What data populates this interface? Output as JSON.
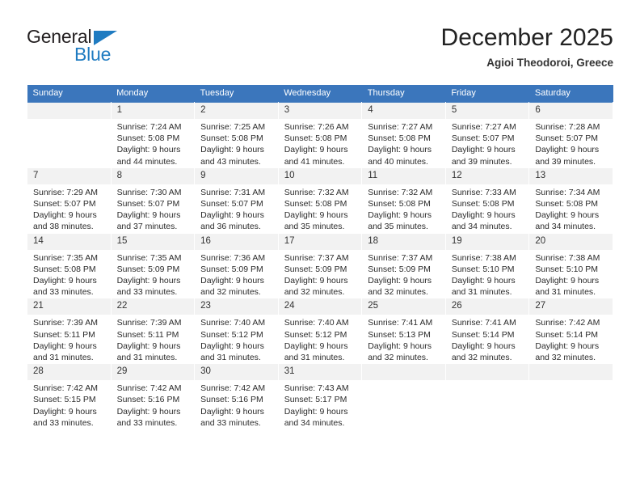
{
  "brand": {
    "name_top": "General",
    "name_bottom": "Blue",
    "triangle_icon": "triangle-icon",
    "color_blue": "#1f7bc1",
    "color_dark": "#231f20"
  },
  "header": {
    "title": "December 2025",
    "subtitle": "Agioi Theodoroi, Greece",
    "accent_color": "#3b76bc"
  },
  "calendar": {
    "weekday_headers": [
      "Sunday",
      "Monday",
      "Tuesday",
      "Wednesday",
      "Thursday",
      "Friday",
      "Saturday"
    ],
    "weeks": [
      [
        {
          "day": "",
          "sunrise": "",
          "sunset": "",
          "daylight_1": "",
          "daylight_2": "",
          "empty": true
        },
        {
          "day": "1",
          "sunrise": "Sunrise: 7:24 AM",
          "sunset": "Sunset: 5:08 PM",
          "daylight_1": "Daylight: 9 hours",
          "daylight_2": "and 44 minutes."
        },
        {
          "day": "2",
          "sunrise": "Sunrise: 7:25 AM",
          "sunset": "Sunset: 5:08 PM",
          "daylight_1": "Daylight: 9 hours",
          "daylight_2": "and 43 minutes."
        },
        {
          "day": "3",
          "sunrise": "Sunrise: 7:26 AM",
          "sunset": "Sunset: 5:08 PM",
          "daylight_1": "Daylight: 9 hours",
          "daylight_2": "and 41 minutes."
        },
        {
          "day": "4",
          "sunrise": "Sunrise: 7:27 AM",
          "sunset": "Sunset: 5:08 PM",
          "daylight_1": "Daylight: 9 hours",
          "daylight_2": "and 40 minutes."
        },
        {
          "day": "5",
          "sunrise": "Sunrise: 7:27 AM",
          "sunset": "Sunset: 5:07 PM",
          "daylight_1": "Daylight: 9 hours",
          "daylight_2": "and 39 minutes."
        },
        {
          "day": "6",
          "sunrise": "Sunrise: 7:28 AM",
          "sunset": "Sunset: 5:07 PM",
          "daylight_1": "Daylight: 9 hours",
          "daylight_2": "and 39 minutes."
        }
      ],
      [
        {
          "day": "7",
          "sunrise": "Sunrise: 7:29 AM",
          "sunset": "Sunset: 5:07 PM",
          "daylight_1": "Daylight: 9 hours",
          "daylight_2": "and 38 minutes."
        },
        {
          "day": "8",
          "sunrise": "Sunrise: 7:30 AM",
          "sunset": "Sunset: 5:07 PM",
          "daylight_1": "Daylight: 9 hours",
          "daylight_2": "and 37 minutes."
        },
        {
          "day": "9",
          "sunrise": "Sunrise: 7:31 AM",
          "sunset": "Sunset: 5:07 PM",
          "daylight_1": "Daylight: 9 hours",
          "daylight_2": "and 36 minutes."
        },
        {
          "day": "10",
          "sunrise": "Sunrise: 7:32 AM",
          "sunset": "Sunset: 5:08 PM",
          "daylight_1": "Daylight: 9 hours",
          "daylight_2": "and 35 minutes."
        },
        {
          "day": "11",
          "sunrise": "Sunrise: 7:32 AM",
          "sunset": "Sunset: 5:08 PM",
          "daylight_1": "Daylight: 9 hours",
          "daylight_2": "and 35 minutes."
        },
        {
          "day": "12",
          "sunrise": "Sunrise: 7:33 AM",
          "sunset": "Sunset: 5:08 PM",
          "daylight_1": "Daylight: 9 hours",
          "daylight_2": "and 34 minutes."
        },
        {
          "day": "13",
          "sunrise": "Sunrise: 7:34 AM",
          "sunset": "Sunset: 5:08 PM",
          "daylight_1": "Daylight: 9 hours",
          "daylight_2": "and 34 minutes."
        }
      ],
      [
        {
          "day": "14",
          "sunrise": "Sunrise: 7:35 AM",
          "sunset": "Sunset: 5:08 PM",
          "daylight_1": "Daylight: 9 hours",
          "daylight_2": "and 33 minutes."
        },
        {
          "day": "15",
          "sunrise": "Sunrise: 7:35 AM",
          "sunset": "Sunset: 5:09 PM",
          "daylight_1": "Daylight: 9 hours",
          "daylight_2": "and 33 minutes."
        },
        {
          "day": "16",
          "sunrise": "Sunrise: 7:36 AM",
          "sunset": "Sunset: 5:09 PM",
          "daylight_1": "Daylight: 9 hours",
          "daylight_2": "and 32 minutes."
        },
        {
          "day": "17",
          "sunrise": "Sunrise: 7:37 AM",
          "sunset": "Sunset: 5:09 PM",
          "daylight_1": "Daylight: 9 hours",
          "daylight_2": "and 32 minutes."
        },
        {
          "day": "18",
          "sunrise": "Sunrise: 7:37 AM",
          "sunset": "Sunset: 5:09 PM",
          "daylight_1": "Daylight: 9 hours",
          "daylight_2": "and 32 minutes."
        },
        {
          "day": "19",
          "sunrise": "Sunrise: 7:38 AM",
          "sunset": "Sunset: 5:10 PM",
          "daylight_1": "Daylight: 9 hours",
          "daylight_2": "and 31 minutes."
        },
        {
          "day": "20",
          "sunrise": "Sunrise: 7:38 AM",
          "sunset": "Sunset: 5:10 PM",
          "daylight_1": "Daylight: 9 hours",
          "daylight_2": "and 31 minutes."
        }
      ],
      [
        {
          "day": "21",
          "sunrise": "Sunrise: 7:39 AM",
          "sunset": "Sunset: 5:11 PM",
          "daylight_1": "Daylight: 9 hours",
          "daylight_2": "and 31 minutes."
        },
        {
          "day": "22",
          "sunrise": "Sunrise: 7:39 AM",
          "sunset": "Sunset: 5:11 PM",
          "daylight_1": "Daylight: 9 hours",
          "daylight_2": "and 31 minutes."
        },
        {
          "day": "23",
          "sunrise": "Sunrise: 7:40 AM",
          "sunset": "Sunset: 5:12 PM",
          "daylight_1": "Daylight: 9 hours",
          "daylight_2": "and 31 minutes."
        },
        {
          "day": "24",
          "sunrise": "Sunrise: 7:40 AM",
          "sunset": "Sunset: 5:12 PM",
          "daylight_1": "Daylight: 9 hours",
          "daylight_2": "and 31 minutes."
        },
        {
          "day": "25",
          "sunrise": "Sunrise: 7:41 AM",
          "sunset": "Sunset: 5:13 PM",
          "daylight_1": "Daylight: 9 hours",
          "daylight_2": "and 32 minutes."
        },
        {
          "day": "26",
          "sunrise": "Sunrise: 7:41 AM",
          "sunset": "Sunset: 5:14 PM",
          "daylight_1": "Daylight: 9 hours",
          "daylight_2": "and 32 minutes."
        },
        {
          "day": "27",
          "sunrise": "Sunrise: 7:42 AM",
          "sunset": "Sunset: 5:14 PM",
          "daylight_1": "Daylight: 9 hours",
          "daylight_2": "and 32 minutes."
        }
      ],
      [
        {
          "day": "28",
          "sunrise": "Sunrise: 7:42 AM",
          "sunset": "Sunset: 5:15 PM",
          "daylight_1": "Daylight: 9 hours",
          "daylight_2": "and 33 minutes."
        },
        {
          "day": "29",
          "sunrise": "Sunrise: 7:42 AM",
          "sunset": "Sunset: 5:16 PM",
          "daylight_1": "Daylight: 9 hours",
          "daylight_2": "and 33 minutes."
        },
        {
          "day": "30",
          "sunrise": "Sunrise: 7:42 AM",
          "sunset": "Sunset: 5:16 PM",
          "daylight_1": "Daylight: 9 hours",
          "daylight_2": "and 33 minutes."
        },
        {
          "day": "31",
          "sunrise": "Sunrise: 7:43 AM",
          "sunset": "Sunset: 5:17 PM",
          "daylight_1": "Daylight: 9 hours",
          "daylight_2": "and 34 minutes."
        },
        {
          "day": "",
          "sunrise": "",
          "sunset": "",
          "daylight_1": "",
          "daylight_2": "",
          "empty": true
        },
        {
          "day": "",
          "sunrise": "",
          "sunset": "",
          "daylight_1": "",
          "daylight_2": "",
          "empty": true
        },
        {
          "day": "",
          "sunrise": "",
          "sunset": "",
          "daylight_1": "",
          "daylight_2": "",
          "empty": true
        }
      ]
    ]
  }
}
